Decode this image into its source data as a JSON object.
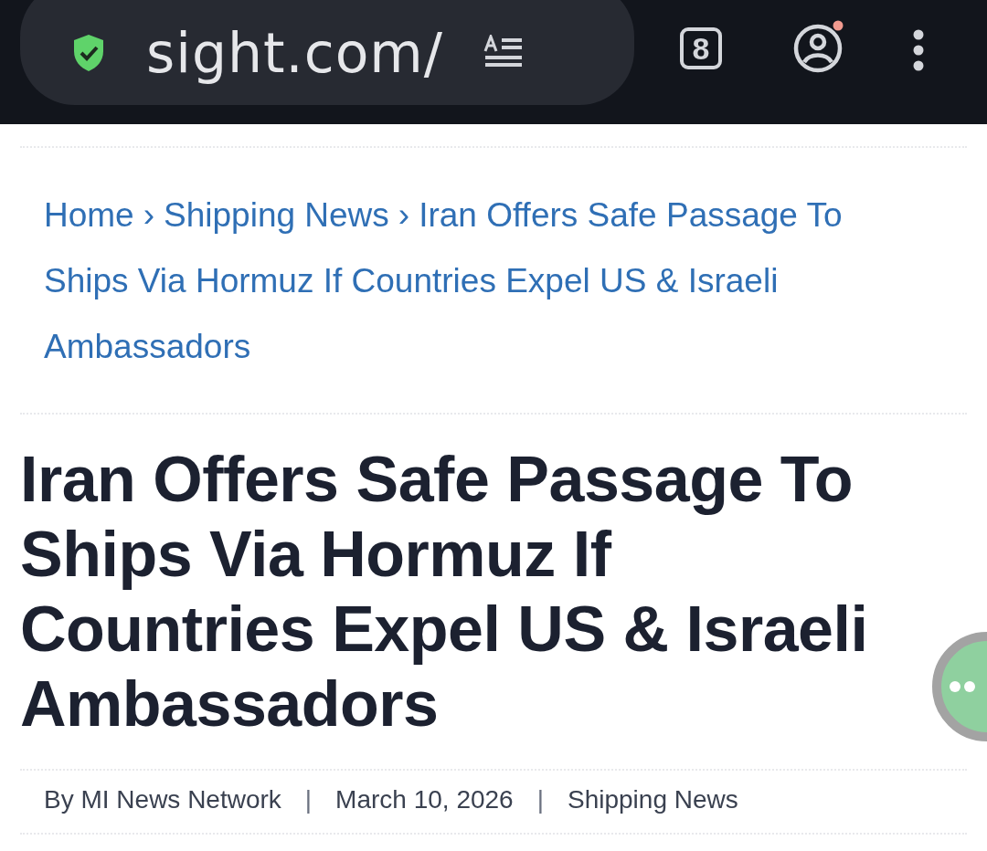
{
  "browser_bar": {
    "url": "sight.com/",
    "tab_count": "8",
    "profile_notification": true
  },
  "breadcrumb": {
    "links": [
      "Home",
      "Shipping News"
    ],
    "separator": "›",
    "current": "Iran Offers Safe Passage To Ships Via Hormuz If Countries Expel US & Israeli Ambassadors"
  },
  "headline": "Iran Offers Safe Passage To Ships Via Hormuz If Countries Expel US & Israeli Ambassadors",
  "meta": {
    "items": [
      "By MI News Network",
      "March 10, 2026",
      "Shipping News"
    ],
    "separator": "|"
  }
}
